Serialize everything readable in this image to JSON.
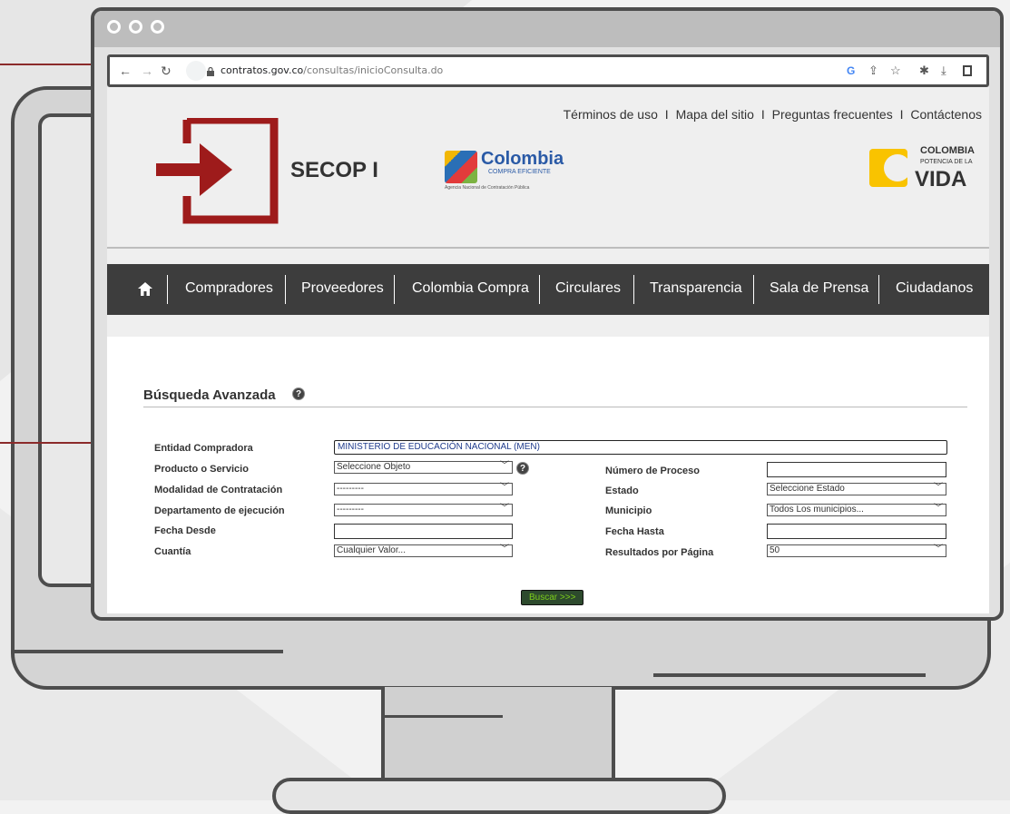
{
  "colors": {
    "accent": "#9e1b1b",
    "dark_bar": "#3d3d3d",
    "button_text": "#7ccd1a"
  },
  "browser": {
    "url_domain": "contratos.gov.co",
    "url_path": "/consultas/inicioConsulta.do",
    "icons": [
      "back-arrow-icon",
      "forward-arrow-icon",
      "reload-icon",
      "lock-icon",
      "google-icon",
      "share-icon",
      "star-icon",
      "puzzle-icon",
      "download-icon",
      "sidebar-icon"
    ]
  },
  "header": {
    "top_links": [
      "Términos de uso",
      "Mapa del sitio",
      "Preguntas frecuentes",
      "Contáctenos"
    ],
    "separator": "I",
    "logo_title": "SECOP I",
    "cce_name": "Colombia",
    "cce_sub": "COMPRA EFICIENTE",
    "cce_agency": "Agencia Nacional de Contratación Pública",
    "gov_line1": "COLOMBIA",
    "gov_line2": "POTENCIA DE LA",
    "gov_line3": "VIDA"
  },
  "nav": {
    "items": [
      "Compradores",
      "Proveedores",
      "Colombia Compra",
      "Circulares",
      "Transparencia",
      "Sala de Prensa",
      "Ciudadanos"
    ]
  },
  "form": {
    "title": "Búsqueda Avanzada",
    "entidad_label": "Entidad Compradora",
    "entidad_value": "MINISTERIO DE EDUCACIÓN NACIONAL (MEN)",
    "producto_label": "Producto o Servicio",
    "producto_value": "Seleccione Objeto",
    "modalidad_label": "Modalidad de Contratación",
    "modalidad_value": "---------",
    "departamento_label": "Departamento de ejecución",
    "departamento_value": "---------",
    "fecha_desde_label": "Fecha Desde",
    "cuantia_label": "Cuantía",
    "cuantia_value": "Cualquier Valor...",
    "numero_label": "Número de Proceso",
    "estado_label": "Estado",
    "estado_value": "Seleccione Estado",
    "municipio_label": "Municipio",
    "municipio_value": "Todos Los municipios...",
    "fecha_hasta_label": "Fecha Hasta",
    "resultados_label": "Resultados por Página",
    "resultados_value": "50",
    "buscar_label": "Buscar >>>"
  }
}
